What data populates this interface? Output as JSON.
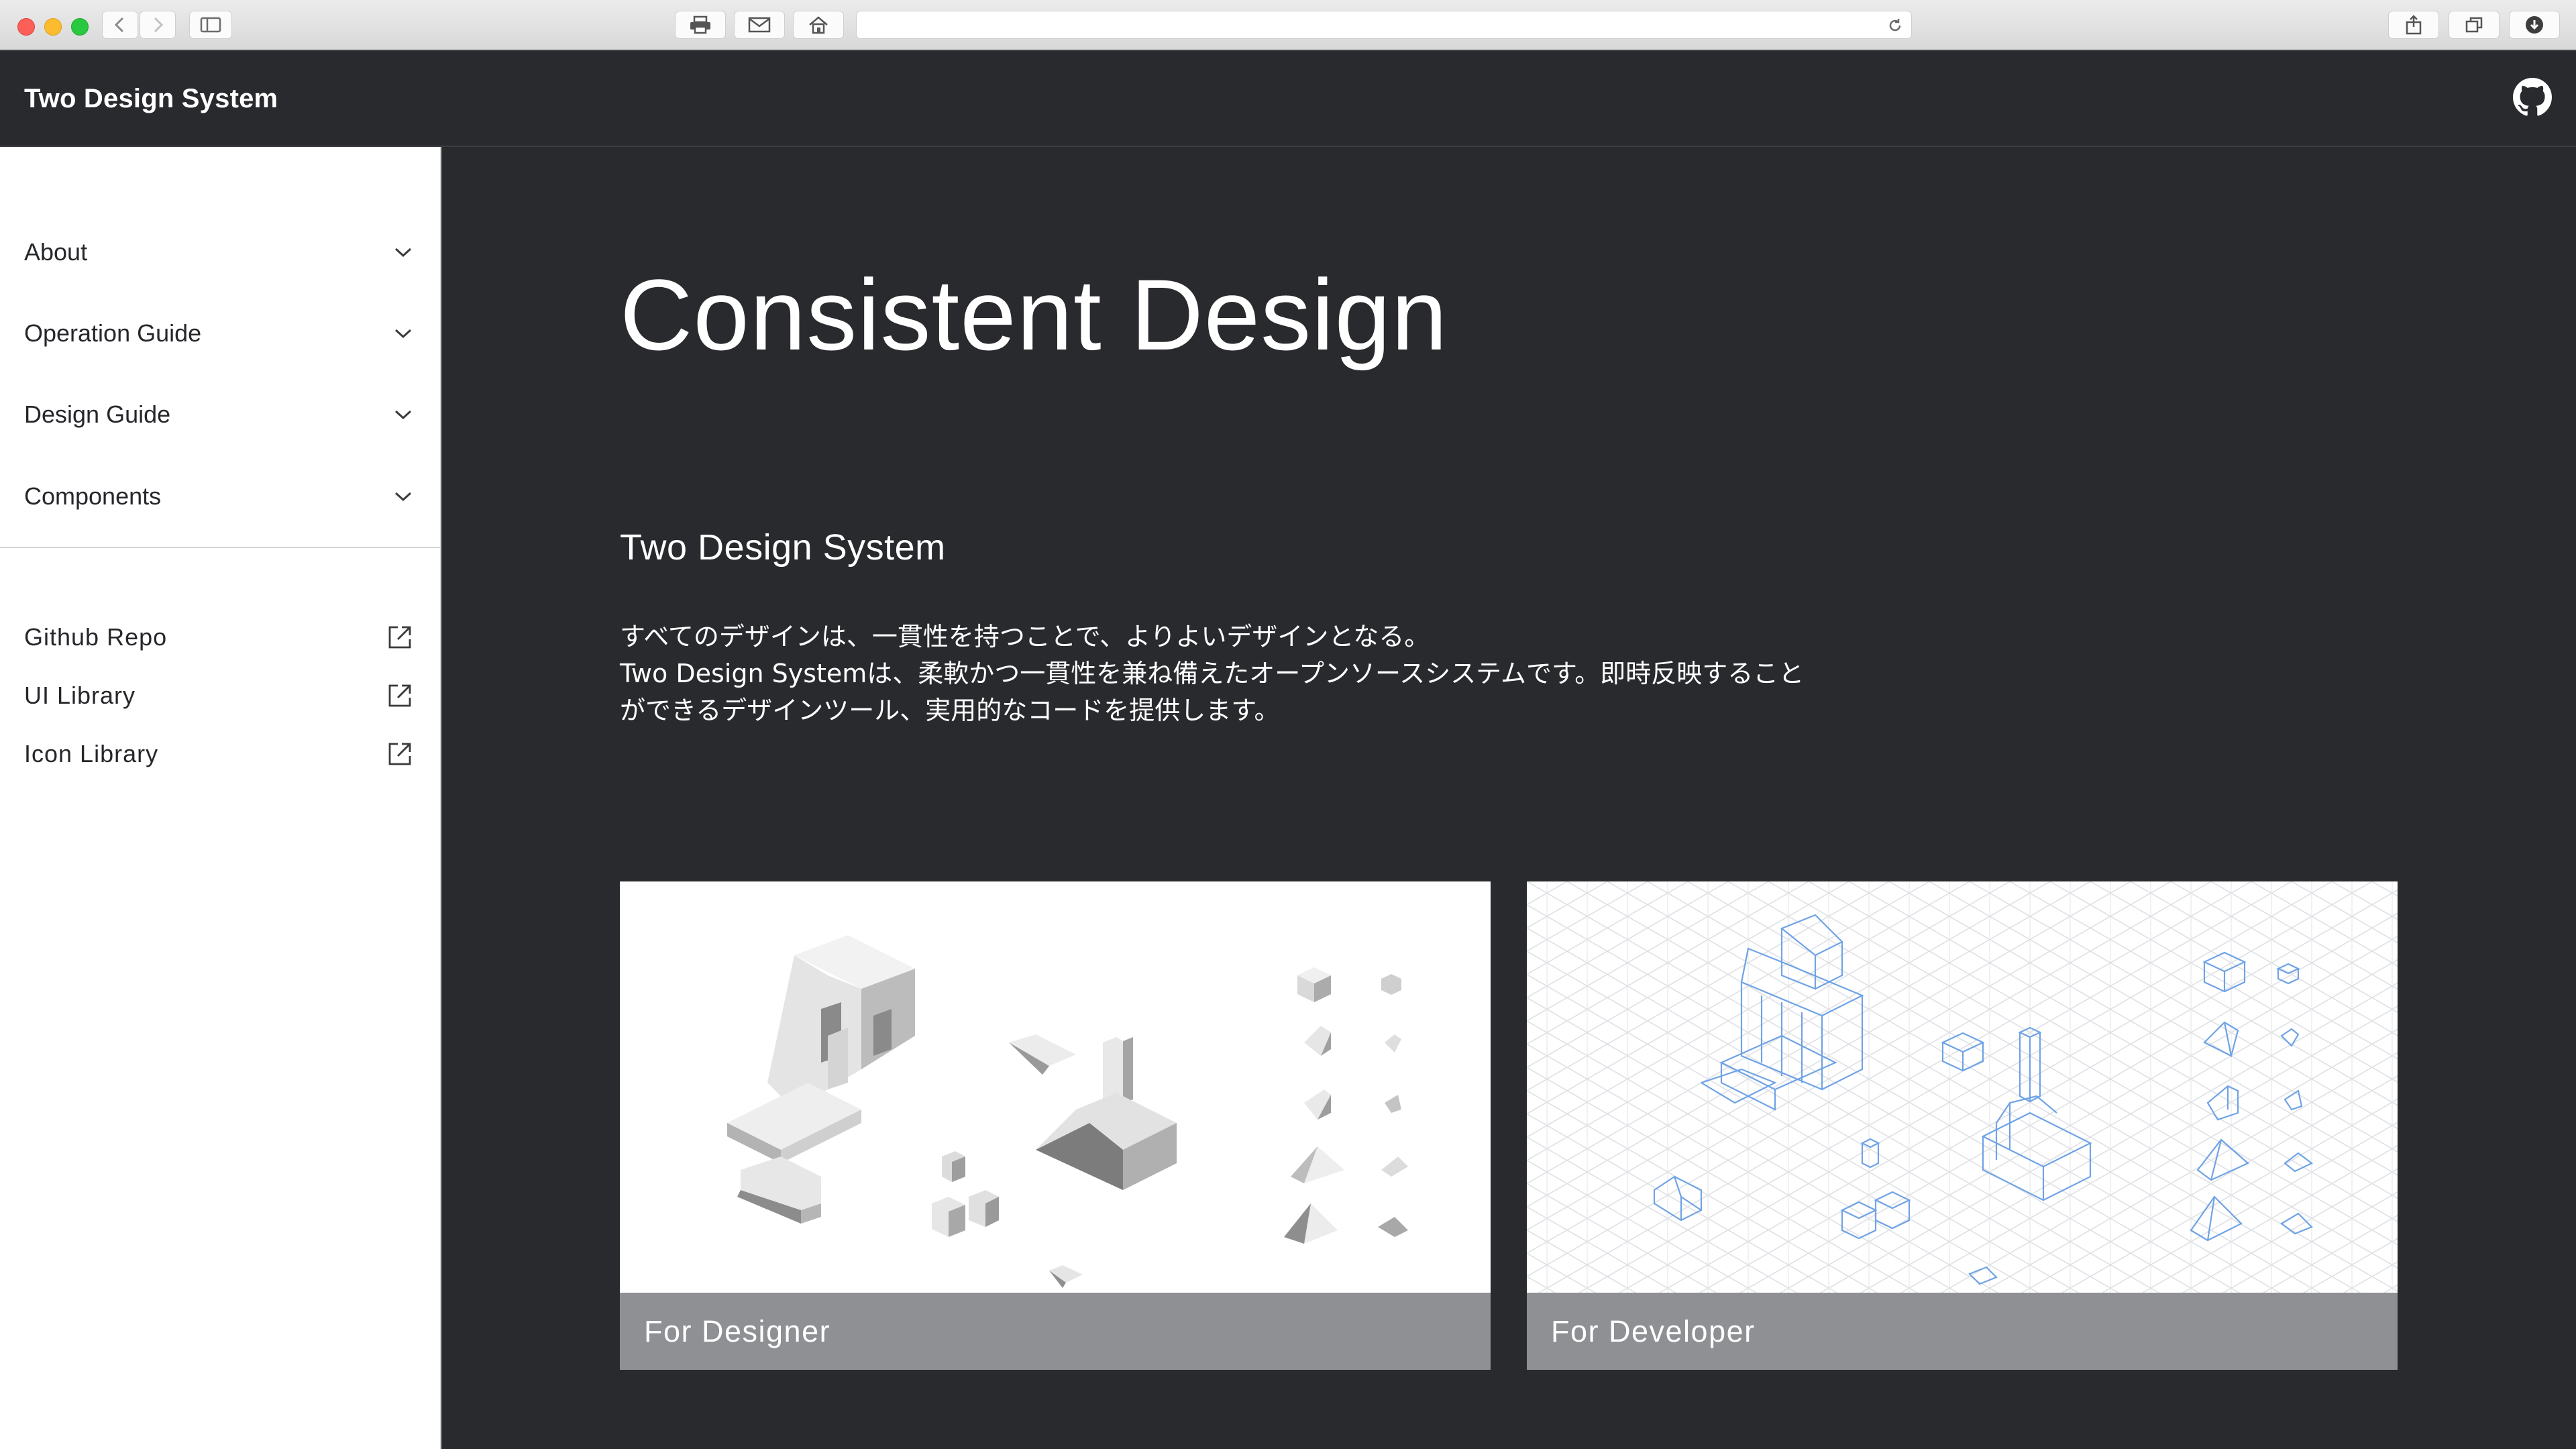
{
  "browser": {
    "address": ""
  },
  "app": {
    "brand": "Two Design System"
  },
  "sidebar": {
    "nav": [
      {
        "label": "About"
      },
      {
        "label": "Operation Guide"
      },
      {
        "label": "Design Guide"
      },
      {
        "label": "Components"
      }
    ],
    "links": [
      {
        "label": "Github Repo"
      },
      {
        "label": "UI Library"
      },
      {
        "label": "Icon Library"
      }
    ]
  },
  "main": {
    "title": "Consistent Design",
    "subtitle": "Two Design System",
    "description": [
      "すべてのデザインは、一貫性を持つことで、よりよいデザインとなる。",
      "Two Design Systemは、柔軟かつ一貫性を兼ね備えたオープンソースシステムです。即時反映すること",
      "ができるデザインツール、実用的なコードを提供します。"
    ],
    "cards": [
      {
        "label": "For Designer"
      },
      {
        "label": "For Developer"
      }
    ]
  },
  "icons": {
    "chrome": [
      "back-icon",
      "forward-icon",
      "sidebar-icon",
      "print-icon",
      "mail-icon",
      "home-icon",
      "reload-icon",
      "share-icon",
      "tabs-icon",
      "download-icon"
    ],
    "header": "github-icon",
    "nav": "chevron-down-icon",
    "links": "external-link-icon"
  },
  "colors": {
    "background": "#292a2e",
    "sidebar": "#ffffff",
    "card_label": "#8f9094",
    "developer_lines": "#6fa3e6"
  }
}
